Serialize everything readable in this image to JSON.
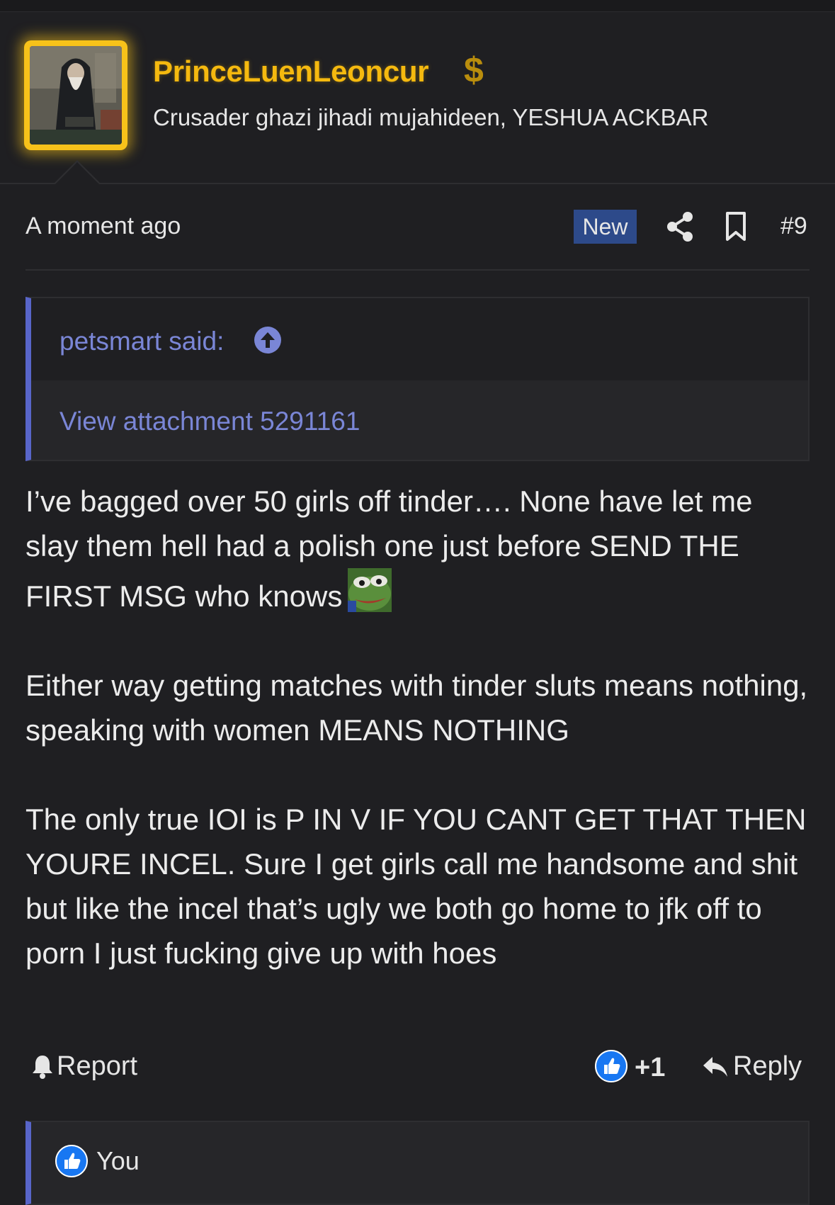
{
  "user": {
    "name": "PrinceLuenLeoncur",
    "title": "Crusader ghazi jihadi mujahideen, YESHUA ACKBAR",
    "badge_icon": "dollar-sign-icon",
    "name_color": "#f5b90f"
  },
  "post": {
    "timestamp": "A moment ago",
    "new_label": "New",
    "number": "#9",
    "quote": {
      "author": "petsmart said:",
      "attachment_link": "View attachment 5291161"
    },
    "body": {
      "p1": "I’ve bagged over 50 girls off tinder…. None have let me slay them hell had a polish one just before SEND THE FIRST MSG who knows",
      "p2": "Either way getting matches with tinder sluts means nothing, speaking with women MEANS NOTHING",
      "p3": "The only true IOI is P IN V IF YOU CANT GET THAT THEN YOURE INCEL. Sure I get girls call me handsome and shit but like the incel that’s ugly we both go home to jfk off to porn I just fucking give up with hoes"
    },
    "emoji": "pepe-frog-emoji"
  },
  "actions": {
    "report_label": "Report",
    "like_count": "+1",
    "reply_label": "Reply"
  },
  "reactions": {
    "users": "You"
  },
  "colors": {
    "background": "#1f1f22",
    "accent_blue": "#5865c9",
    "link": "#7a86d6",
    "new_badge": "#2d4a8a",
    "like_blue": "#1877f2"
  }
}
